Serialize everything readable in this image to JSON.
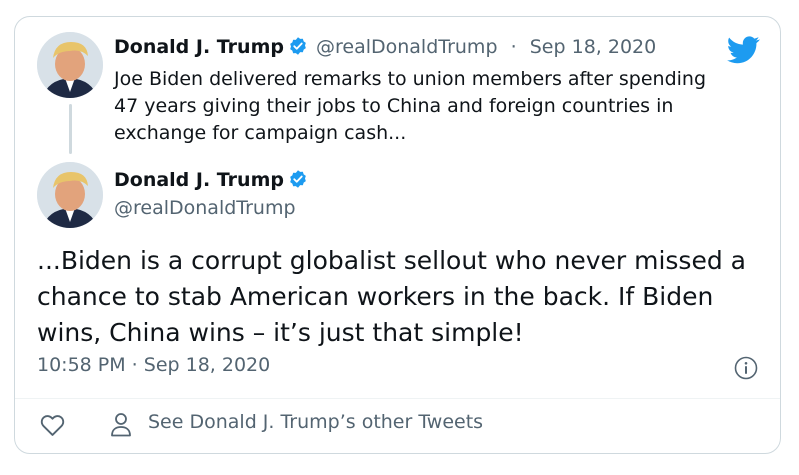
{
  "tweet1": {
    "name": "Donald J. Trump",
    "handle": "@realDonaldTrump",
    "separator": "·",
    "date": "Sep 18, 2020",
    "text": "Joe Biden delivered remarks to union members after spending 47 years giving their jobs to China and foreign countries in exchange for campaign cash..."
  },
  "tweet2": {
    "name": "Donald J. Trump",
    "handle": "@realDonaldTrump",
    "text": "...Biden is a corrupt globalist sellout who never missed a chance to stab American workers in the back. If Biden wins, China wins – it’s just that simple!",
    "meta": "10:58 PM · Sep 18, 2020"
  },
  "footer": {
    "other_tweets": "See Donald J. Trump’s other Tweets"
  },
  "icons": {
    "brand": "twitter-bird-icon",
    "verified": "verified-badge-icon",
    "info": "info-icon",
    "like": "heart-icon",
    "profile": "person-icon"
  },
  "colors": {
    "twitter_blue": "#1d9bf0",
    "text_primary": "#0f1419",
    "text_secondary": "#536471",
    "border": "#cfd9de"
  }
}
